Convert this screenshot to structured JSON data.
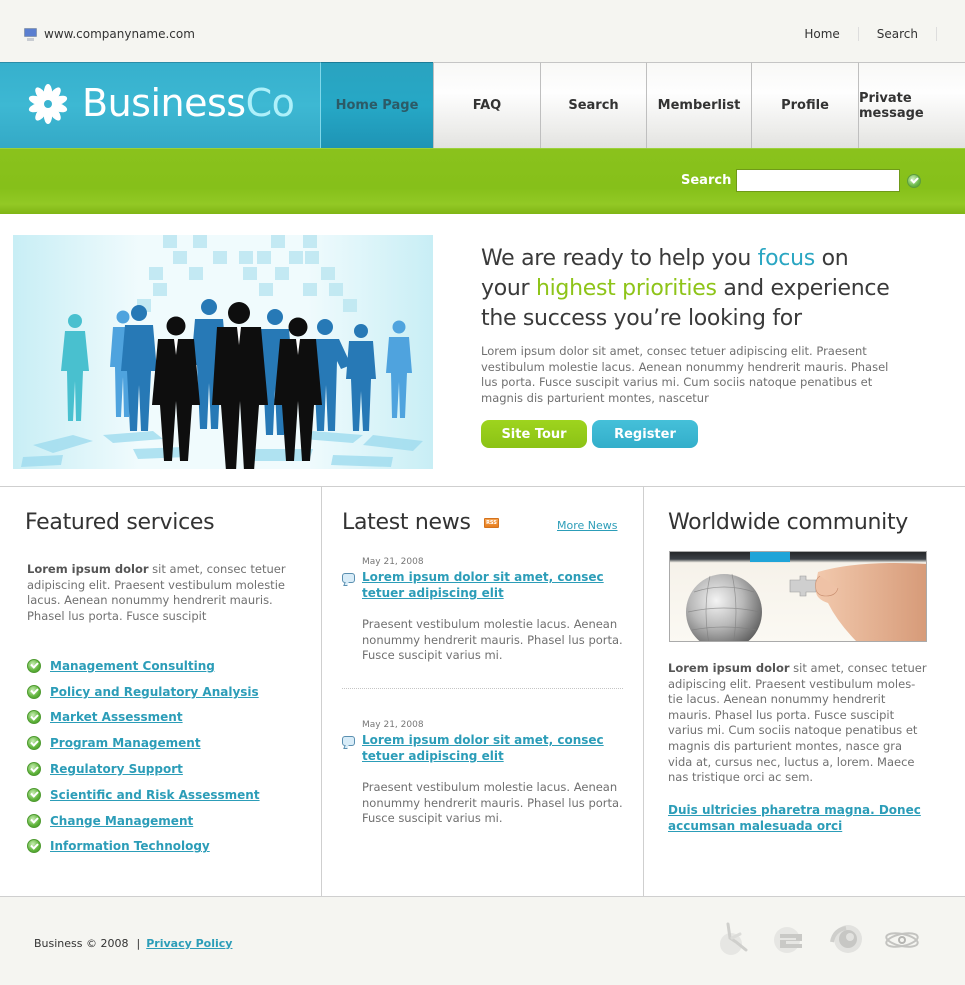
{
  "topbar": {
    "site_icon": "computer-icon",
    "url": "www.companyname.com",
    "links": [
      "Home",
      "Search"
    ]
  },
  "header": {
    "logo_icon": "flower-logo-icon",
    "logo_main": "Business",
    "logo_accent": "Co",
    "nav": [
      {
        "label": "Home Page",
        "active": true
      },
      {
        "label": "FAQ",
        "active": false
      },
      {
        "label": "Search",
        "active": false
      },
      {
        "label": "Memberlist",
        "active": false
      },
      {
        "label": "Profile",
        "active": false
      },
      {
        "label": "Private message",
        "active": false
      }
    ]
  },
  "searchbar": {
    "label": "Search",
    "value": "",
    "placeholder": "",
    "submit_icon": "check-circle-icon"
  },
  "hero": {
    "image_alt": "business people silhouettes",
    "title_parts": {
      "a": "We are ready to help you ",
      "focus": "focus",
      "b": " on your ",
      "priorities": "highest priorities",
      "c": " and experience the success you’re looking for"
    },
    "body": "Lorem ipsum dolor sit amet, consec tetuer adipiscing elit. Praesent vestibulum molestie lacus. Aenean nonummy hendrerit mauris. Phasel lus porta. Fusce suscipit varius mi. Cum sociis natoque penatibus et magnis dis parturient montes, nascetur",
    "buttons": {
      "site_tour": "Site Tour",
      "register": "Register"
    }
  },
  "featured": {
    "title": "Featured services",
    "lead_bold": "Lorem ipsum dolor",
    "lead_rest": " sit amet, consec tetuer adipiscing elit. Praesent vestibulum molestie lacus. Aenean nonummy hendrerit mauris. Phasel lus porta. Fusce suscipit",
    "services": [
      "Management Consulting",
      "Policy and Regulatory Analysis",
      "Market Assessment",
      "Program Management",
      "Regulatory Support",
      "Scientific and Risk Assessment",
      "Change Management",
      "Information Technology"
    ]
  },
  "news": {
    "title": "Latest news",
    "rss_label": "RSS",
    "more_link": "More News",
    "items": [
      {
        "date": "May 21, 2008",
        "title": "Lorem ipsum dolor sit amet, consec tetuer adipiscing elit",
        "body": "Praesent vestibulum molestie lacus. Aenean nonummy hendrerit mauris. Phasel lus porta. Fusce suscipit varius mi."
      },
      {
        "date": "May 21, 2008",
        "title": "Lorem ipsum dolor sit amet, consec tetuer adipiscing elit",
        "body": "Praesent vestibulum molestie lacus. Aenean nonummy hendrerit mauris. Phasel lus porta. Fusce suscipit varius mi."
      }
    ]
  },
  "community": {
    "title": "Worldwide community",
    "image_alt": "puzzle globe and hand",
    "lead_bold": "Lorem ipsum dolor",
    "lead_rest": " sit amet, consec tetuer adipiscing elit. Praesent vestibulum moles-tie lacus. Aenean nonummy hendrerit mauris. Phasel lus porta. Fusce suscipit varius mi. Cum sociis natoque penatibus et magnis dis parturient montes, nasce gra vida at, cursus nec, luctus a, lorem. Maece nas tristique orci ac sem.",
    "link": "Duis ultricies pharetra magna. Donec accumsan malesuada orci"
  },
  "footer": {
    "copyright": "Business © 2008",
    "separator": "|",
    "privacy": "Privacy Policy",
    "partner_icons": [
      "accessibility-logo-icon",
      "e-logo-icon",
      "swirl-logo-icon",
      "atom-logo-icon"
    ]
  },
  "colors": {
    "brand_blue": "#36b0cd",
    "brand_green": "#8ac21c",
    "link": "#2c9db8"
  }
}
